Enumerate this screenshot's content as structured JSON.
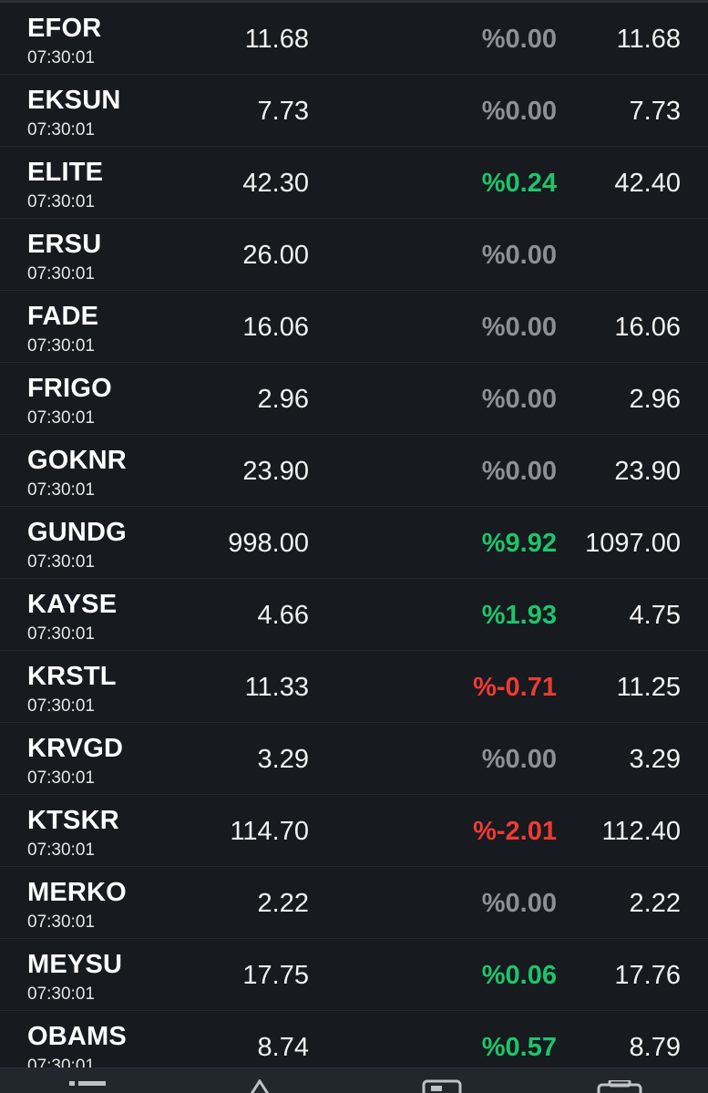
{
  "colors": {
    "background": "#171a1f",
    "flat": "#8d9197",
    "up": "#1fc46b",
    "down": "#ef3b36"
  },
  "rows": [
    {
      "symbol": "EFOR",
      "time": "07:30:01",
      "last": "11.68",
      "change": "%0.00",
      "trend": "flat",
      "close": "11.68"
    },
    {
      "symbol": "EKSUN",
      "time": "07:30:01",
      "last": "7.73",
      "change": "%0.00",
      "trend": "flat",
      "close": "7.73"
    },
    {
      "symbol": "ELITE",
      "time": "07:30:01",
      "last": "42.30",
      "change": "%0.24",
      "trend": "up",
      "close": "42.40"
    },
    {
      "symbol": "ERSU",
      "time": "07:30:01",
      "last": "26.00",
      "change": "%0.00",
      "trend": "flat",
      "close": ""
    },
    {
      "symbol": "FADE",
      "time": "07:30:01",
      "last": "16.06",
      "change": "%0.00",
      "trend": "flat",
      "close": "16.06"
    },
    {
      "symbol": "FRIGO",
      "time": "07:30:01",
      "last": "2.96",
      "change": "%0.00",
      "trend": "flat",
      "close": "2.96"
    },
    {
      "symbol": "GOKNR",
      "time": "07:30:01",
      "last": "23.90",
      "change": "%0.00",
      "trend": "flat",
      "close": "23.90"
    },
    {
      "symbol": "GUNDG",
      "time": "07:30:01",
      "last": "998.00",
      "change": "%9.92",
      "trend": "up",
      "close": "1097.00"
    },
    {
      "symbol": "KAYSE",
      "time": "07:30:01",
      "last": "4.66",
      "change": "%1.93",
      "trend": "up",
      "close": "4.75"
    },
    {
      "symbol": "KRSTL",
      "time": "07:30:01",
      "last": "11.33",
      "change": "%-0.71",
      "trend": "down",
      "close": "11.25"
    },
    {
      "symbol": "KRVGD",
      "time": "07:30:01",
      "last": "3.29",
      "change": "%0.00",
      "trend": "flat",
      "close": "3.29"
    },
    {
      "symbol": "KTSKR",
      "time": "07:30:01",
      "last": "114.70",
      "change": "%-2.01",
      "trend": "down",
      "close": "112.40"
    },
    {
      "symbol": "MERKO",
      "time": "07:30:01",
      "last": "2.22",
      "change": "%0.00",
      "trend": "flat",
      "close": "2.22"
    },
    {
      "symbol": "MEYSU",
      "time": "07:30:01",
      "last": "17.75",
      "change": "%0.06",
      "trend": "up",
      "close": "17.76"
    },
    {
      "symbol": "OBAMS",
      "time": "07:30:01",
      "last": "8.74",
      "change": "%0.57",
      "trend": "up",
      "close": "8.79"
    }
  ],
  "bottom_nav": {
    "items": [
      {
        "icon": "list-icon"
      },
      {
        "icon": "chart-icon"
      },
      {
        "icon": "news-icon"
      },
      {
        "icon": "portfolio-icon"
      }
    ]
  }
}
